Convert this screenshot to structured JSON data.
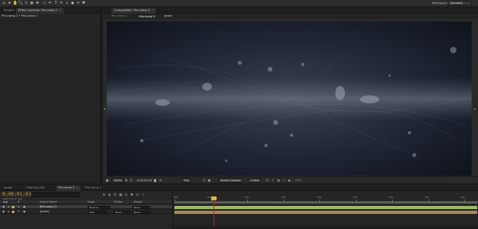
{
  "toolbar": {
    "workspace_label": "Workspace:",
    "workspace_value": "Standard",
    "tool_icons": [
      "home-icon",
      "hand-icon",
      "zoom-icon",
      "rotate-icon",
      "camera-icon",
      "pan-icon",
      "mask-icon",
      "pen-icon",
      "text-icon",
      "brush-icon",
      "stamp-icon",
      "eraser-icon",
      "roto-icon",
      "puppet-icon"
    ]
  },
  "left_panel": {
    "tabs": [
      {
        "label": "Project",
        "active": false
      },
      {
        "label": "Effect Controls: Pre-comp 1",
        "active": true
      }
    ],
    "breadcrumb": "Pre-comp 2 • Pre-comp 1"
  },
  "comp_panel": {
    "tab_label": "Composition: Pre-comp 2",
    "crumbs": [
      "Pre-comp 1",
      "Pre-comp 2",
      "probe"
    ]
  },
  "viewer_controls": {
    "zoom": "100%",
    "timecode": "0;00;01;03",
    "resolution": "Full",
    "camera": "Active Camera",
    "views": "1 View",
    "exposure": "+0.0"
  },
  "timeline": {
    "tabs": [
      "probe",
      "Overlays_HD",
      "Pre-comp 2",
      "Pre-comp 1"
    ],
    "active_tab": "Pre-comp 2",
    "current_time": "0;00;01;03",
    "frame_info": "00033 (29.97 fps)",
    "columns": {
      "num": "#",
      "source_name": "Source Name",
      "mode": "Mode",
      "track_matte": "TrkMat",
      "parent": "Parent"
    },
    "layers": [
      {
        "num": "1",
        "name": "[Pre-comp 1]",
        "mode": "Normal",
        "track_matte": "",
        "parent": "None",
        "color": "#a8c47a",
        "selected": true
      },
      {
        "num": "2",
        "name": "[probe]",
        "mode": "Add",
        "track_matte": "None",
        "parent": "None",
        "color": "#c7a16a",
        "selected": false
      }
    ],
    "ruler_labels": [
      "00s",
      "05s",
      "10s",
      "15s",
      "20s",
      "25s",
      "30s",
      "35s",
      "40s"
    ]
  }
}
